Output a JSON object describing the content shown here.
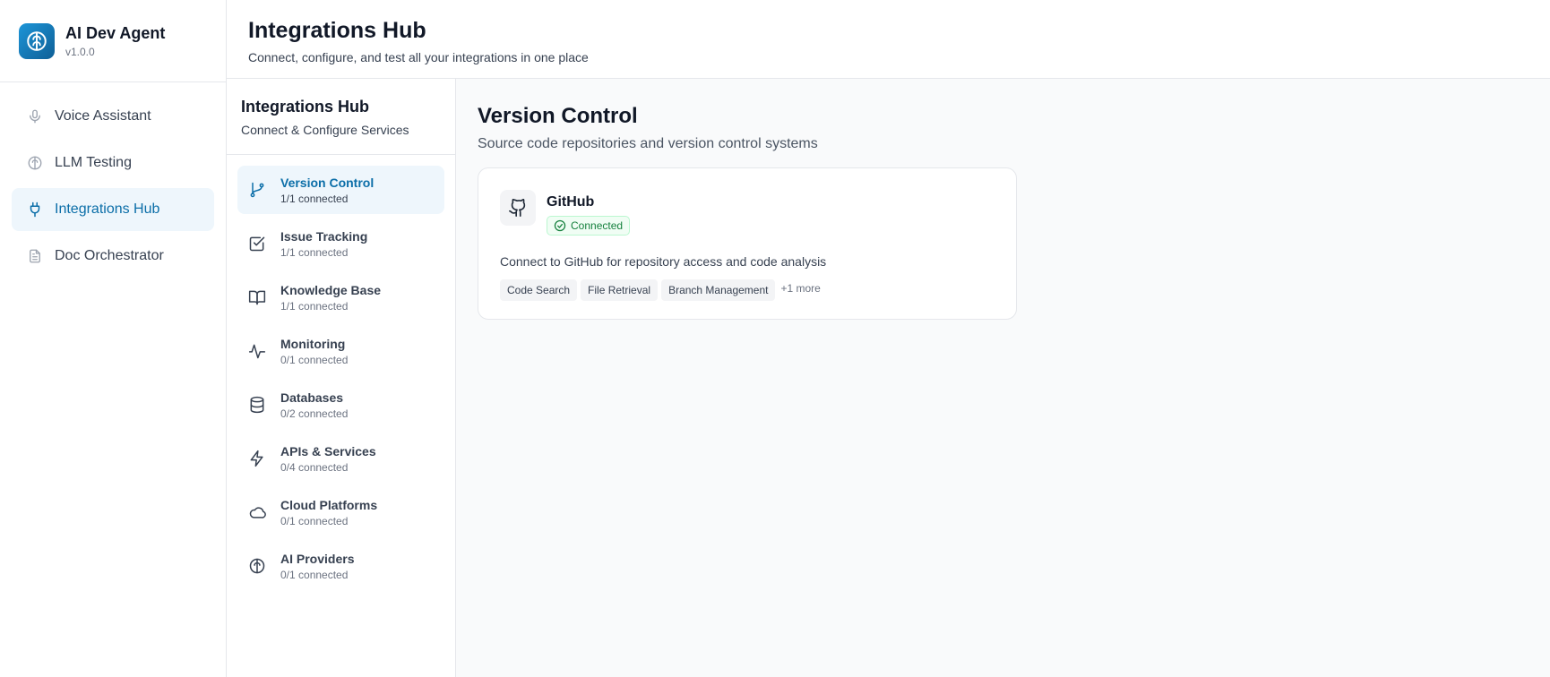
{
  "app": {
    "name": "AI Dev Agent",
    "version": "v1.0.0",
    "accent_color": "#0b6ea8"
  },
  "app_nav": [
    {
      "label": "Voice Assistant",
      "icon": "microphone-icon",
      "active": false
    },
    {
      "label": "LLM Testing",
      "icon": "brain-icon",
      "active": false
    },
    {
      "label": "Integrations Hub",
      "icon": "plug-icon",
      "active": true
    },
    {
      "label": "Doc Orchestrator",
      "icon": "document-icon",
      "active": false
    }
  ],
  "header": {
    "title": "Integrations Hub",
    "subtitle": "Connect, configure, and test all your integrations in one place"
  },
  "category_panel": {
    "title": "Integrations Hub",
    "subtitle": "Connect & Configure Services",
    "items": [
      {
        "name": "Version Control",
        "count": "1/1 connected",
        "icon": "git-branch-icon",
        "active": true
      },
      {
        "name": "Issue Tracking",
        "count": "1/1 connected",
        "icon": "checkbox-icon",
        "active": false
      },
      {
        "name": "Knowledge Base",
        "count": "1/1 connected",
        "icon": "book-icon",
        "active": false
      },
      {
        "name": "Monitoring",
        "count": "0/1 connected",
        "icon": "activity-icon",
        "active": false
      },
      {
        "name": "Databases",
        "count": "0/2 connected",
        "icon": "database-icon",
        "active": false
      },
      {
        "name": "APIs & Services",
        "count": "0/4 connected",
        "icon": "lightning-icon",
        "active": false
      },
      {
        "name": "Cloud Platforms",
        "count": "0/1 connected",
        "icon": "cloud-icon",
        "active": false
      },
      {
        "name": "AI Providers",
        "count": "0/1 connected",
        "icon": "brain-icon",
        "active": false
      }
    ]
  },
  "main": {
    "title": "Version Control",
    "subtitle": "Source code repositories and version control systems",
    "cards": [
      {
        "name": "GitHub",
        "icon": "github-icon",
        "status": "Connected",
        "status_color": "#15803d",
        "description": "Connect to GitHub for repository access and code analysis",
        "tags": [
          "Code Search",
          "File Retrieval",
          "Branch Management"
        ],
        "more": "+1 more"
      }
    ]
  }
}
